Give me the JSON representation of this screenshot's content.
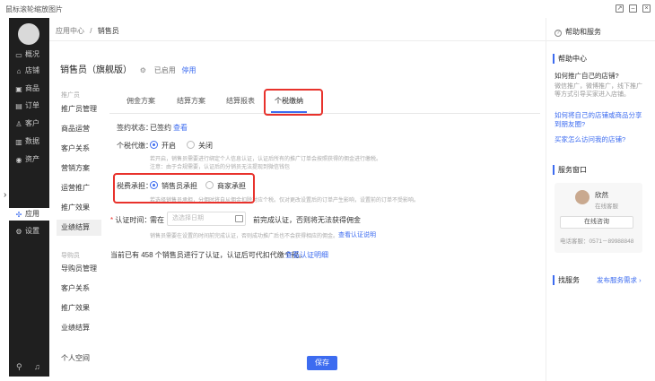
{
  "window": {
    "title": "鼠标滚轮缩放图片"
  },
  "nav": {
    "items": [
      {
        "icon": "monitor-icon",
        "label": "概况"
      },
      {
        "icon": "store-icon",
        "label": "店铺"
      },
      {
        "icon": "goods-icon",
        "label": "商品"
      },
      {
        "icon": "order-icon",
        "label": "订单"
      },
      {
        "icon": "customer-icon",
        "label": "客户"
      },
      {
        "icon": "data-icon",
        "label": "数据"
      },
      {
        "icon": "asset-icon",
        "label": "资产"
      },
      {
        "icon": "apps-icon",
        "label": "应用"
      },
      {
        "icon": "settings-icon",
        "label": "设置"
      }
    ]
  },
  "breadcrumb": {
    "root": "应用中心",
    "sep": "/",
    "current": "销售员"
  },
  "page": {
    "title": "销售员（旗舰版）",
    "status": "已启用",
    "action": "停用"
  },
  "submenu": {
    "group1": "推广员",
    "group1_items": [
      "推广员管理",
      "商品运营",
      "客户关系",
      "营销方案",
      "运营推广",
      "推广效果",
      "业绩结算"
    ],
    "group2": "导购员",
    "group2_items": [
      "导购员管理",
      "客户关系",
      "推广效果",
      "业绩结算"
    ],
    "extra": "个人空间"
  },
  "tabs": [
    "佣金方案",
    "结算方案",
    "结算报表",
    "个税缴纳"
  ],
  "form": {
    "sign_label": "签约状态：",
    "sign_value": "已签约",
    "sign_link": "查看",
    "tax_label": "个税代缴：",
    "tax_on": "开启",
    "tax_off": "关闭",
    "tax_note1": "若开启，销售员需要进行绑定个人信息认证，认证后所有的推广订单会按照获得的佣金进行缴税。",
    "tax_note2": "注意：由于合规需要，认证后的分销员无法提现到微信钱包",
    "fee_label": "税费承担：",
    "fee_opt1": "销售员承担",
    "fee_opt2": "商家承担",
    "fee_note": "若选择销售员承担，分佣时将自从佣金扣除对应个税。仅对更改设置后的订单产生影响，设置前的订单不受影响。",
    "auth_label": "认证时间：",
    "auth_prefix": "需在",
    "date_placeholder": "选选择日期",
    "auth_suffix": "前完成认证，否则将无法获得佣金",
    "auth_note": "销售员需要在设置的时间前完成认证，否则成功推广后也不会获得相应的佣金。",
    "auth_note_link": "查看认证说明",
    "summary": "当前已有 458 个销售员进行了认证，认证后可代扣代缴个税。",
    "summary_link": "查看认证明细",
    "save": "保存"
  },
  "right_panel": {
    "header": "帮助和服务",
    "help_title": "帮助中心",
    "q1": "如何推广自己的店铺?",
    "q1_desc": "微信推广，微博推广，线下推广等方式引导买家进入店铺。",
    "link1": "如何将自己的店铺或商品分享到朋友圈?",
    "link2": "买家怎么访问我的店铺?",
    "service_title": "服务窗口",
    "agent_name": "欣然",
    "agent_role": "在线客服",
    "consult": "在线咨询",
    "phone": "电话客服：0571－89988848",
    "find_title": "找服务",
    "find_link": "发布服务需求 ›"
  }
}
